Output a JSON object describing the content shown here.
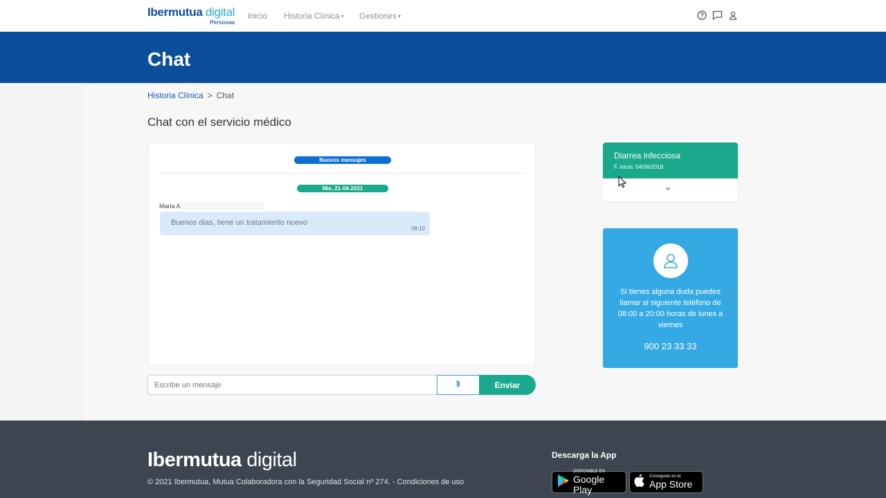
{
  "header": {
    "logo_main_a": "Ibermutua",
    "logo_main_b": " digital",
    "logo_sub": "Personas",
    "nav": [
      {
        "label": "Inicio",
        "has_caret": false
      },
      {
        "label": "Historia Clínica",
        "has_caret": true
      },
      {
        "label": "Gestiones",
        "has_caret": true
      }
    ],
    "icons": [
      "help-circle-icon",
      "chat-bubble-icon",
      "user-icon"
    ]
  },
  "banner": {
    "title": "Chat"
  },
  "breadcrumb": {
    "items": [
      "Historia Clínica",
      "Chat"
    ],
    "separator": ">"
  },
  "page": {
    "title": "Chat con el servicio médico"
  },
  "chat": {
    "new_messages_label": "Nuevos mensajes",
    "date_label": "Mie, 21-04-2021",
    "messages": [
      {
        "sender": "Maria A",
        "text": "Buenos dias, tiene un tratamiento nuevo",
        "time": "08:10"
      }
    ],
    "input_placeholder": "Escribe un mensaje",
    "attach_icon": "paperclip-icon",
    "send_label": "Enviar"
  },
  "episode": {
    "title": "Diarrea infecciosa",
    "date": "F. inicio: 04/06/2018",
    "toggle_icon": "chevron-down-icon"
  },
  "info_card": {
    "avatar_icon": "user-icon",
    "text": "Si tienes alguna duda puedes llamar al siguiente teléfono de 08:00 a 20:00 horas de lunes a viernes",
    "phone": "900 23 33 33"
  },
  "footer": {
    "logo_a": "Ibermutua",
    "logo_b": " digital",
    "copyright": "© 2021 Ibermutua, Mutua Colaboradora con la Seguridad Social nº 274. - Condiciones de uso",
    "download_label": "Descarga la App",
    "google_small": "DISPONIBLE EN",
    "google_big": "Google Play",
    "apple_small": "Consíguelo en el",
    "apple_big": "App Store"
  },
  "colors": {
    "brand_blue": "#0b4f9c",
    "accent_green": "#1aa98c",
    "info_blue": "#35a9e3",
    "footer_gray": "#3d4650"
  }
}
